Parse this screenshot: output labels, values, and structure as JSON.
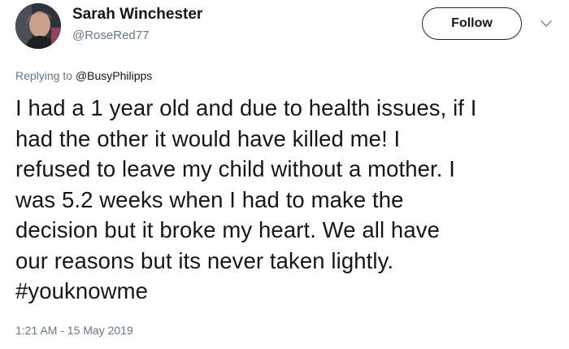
{
  "user": {
    "display_name": "Sarah Winchester",
    "handle": "@RoseRed77"
  },
  "follow_label": "Follow",
  "reply": {
    "prefix": "Replying to",
    "mention": "@BusyPhilipps"
  },
  "tweet_lines": [
    "I had a 1 year old and due to health issues, if I",
    "had the other it would have killed me! I",
    "refused to leave my child without a mother. I",
    "was 5.2 weeks when I had to make the",
    "decision but it broke my heart. We all have",
    "our reasons but its never taken lightly.",
    "#youknowme"
  ],
  "timestamp": "1:21 AM - 15 May 2019",
  "icons": {
    "avatar": "avatar-photo",
    "caret": "chevron-down-icon"
  },
  "colors": {
    "text": "#14171a",
    "secondary": "#657786",
    "button_border": "#1f2428"
  }
}
